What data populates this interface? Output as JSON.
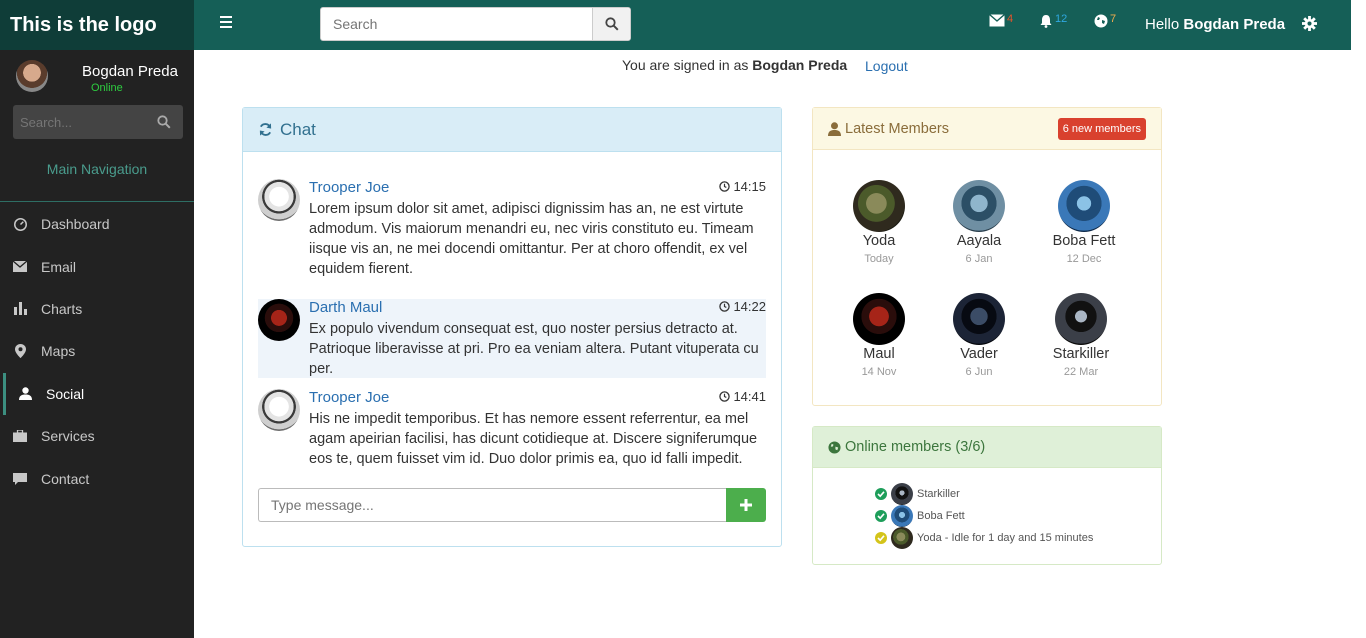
{
  "brand": {
    "logo_text": "This is the logo"
  },
  "header": {
    "search_placeholder": "Search",
    "mail_count": "4",
    "bell_count": "12",
    "globe_count": "7",
    "hello_prefix": "Hello",
    "hello_name": "Bogdan Preda",
    "colors": {
      "mail": "#e8542b",
      "bell": "#2fa8e0",
      "globe": "#f0ad4e"
    }
  },
  "sidebar": {
    "user_name": "Bogdan Preda",
    "user_status": "Online",
    "search_placeholder": "Search...",
    "nav_title": "Main Navigation",
    "items": [
      {
        "label": "Dashboard",
        "icon": "dashboard-icon"
      },
      {
        "label": "Email",
        "icon": "envelope-icon"
      },
      {
        "label": "Charts",
        "icon": "bar-chart-icon"
      },
      {
        "label": "Maps",
        "icon": "map-marker-icon"
      },
      {
        "label": "Social",
        "icon": "user-icon"
      },
      {
        "label": "Services",
        "icon": "briefcase-icon"
      },
      {
        "label": "Contact",
        "icon": "comment-icon"
      }
    ],
    "active": "Social"
  },
  "signin": {
    "prefix": "You are signed in as",
    "name": "Bogdan Preda",
    "logout": "Logout"
  },
  "chat": {
    "title": "Chat",
    "messages": [
      {
        "author": "Trooper Joe",
        "time": "14:15",
        "text": "Lorem ipsum dolor sit amet, adipisci dignissim has an, ne est virtute admodum. Vis maiorum menandri eu, nec viris constituto eu. Timeam iisque vis an, ne mei docendi omittantur. Per at choro offendit, ex vel equidem fierent."
      },
      {
        "author": "Darth Maul",
        "time": "14:22",
        "text": "Ex populo vivendum consequat est, quo noster persius detracto at. Patrioque liberavisse at pri. Pro ea veniam altera. Putant vituperata cu per."
      },
      {
        "author": "Trooper Joe",
        "time": "14:41",
        "text": "His ne impedit temporibus. Et has nemore essent referrentur, ea mel agam apeirian facilisi, has dicunt cotidieque at. Discere signiferumque eos te, quem fuisset vim id. Duo dolor primis ea, quo id falli impedit."
      }
    ],
    "input_placeholder": "Type message..."
  },
  "latest_members": {
    "title": "Latest Members",
    "badge": "6 new members",
    "members": [
      {
        "name": "Yoda",
        "date": "Today"
      },
      {
        "name": "Aayala",
        "date": "6 Jan"
      },
      {
        "name": "Boba Fett",
        "date": "12 Dec"
      },
      {
        "name": "Maul",
        "date": "14 Nov"
      },
      {
        "name": "Vader",
        "date": "6 Jun"
      },
      {
        "name": "Starkiller",
        "date": "22 Mar"
      }
    ]
  },
  "online_members": {
    "title": "Online members (3/6)",
    "list": [
      {
        "label": "Starkiller",
        "status": "online",
        "status_color": "#1e9e5a"
      },
      {
        "label": "Boba Fett",
        "status": "online",
        "status_color": "#1e9e5a"
      },
      {
        "label": "Yoda - Idle for 1 day and 15 minutes",
        "status": "idle",
        "status_color": "#d4c41a"
      }
    ]
  }
}
